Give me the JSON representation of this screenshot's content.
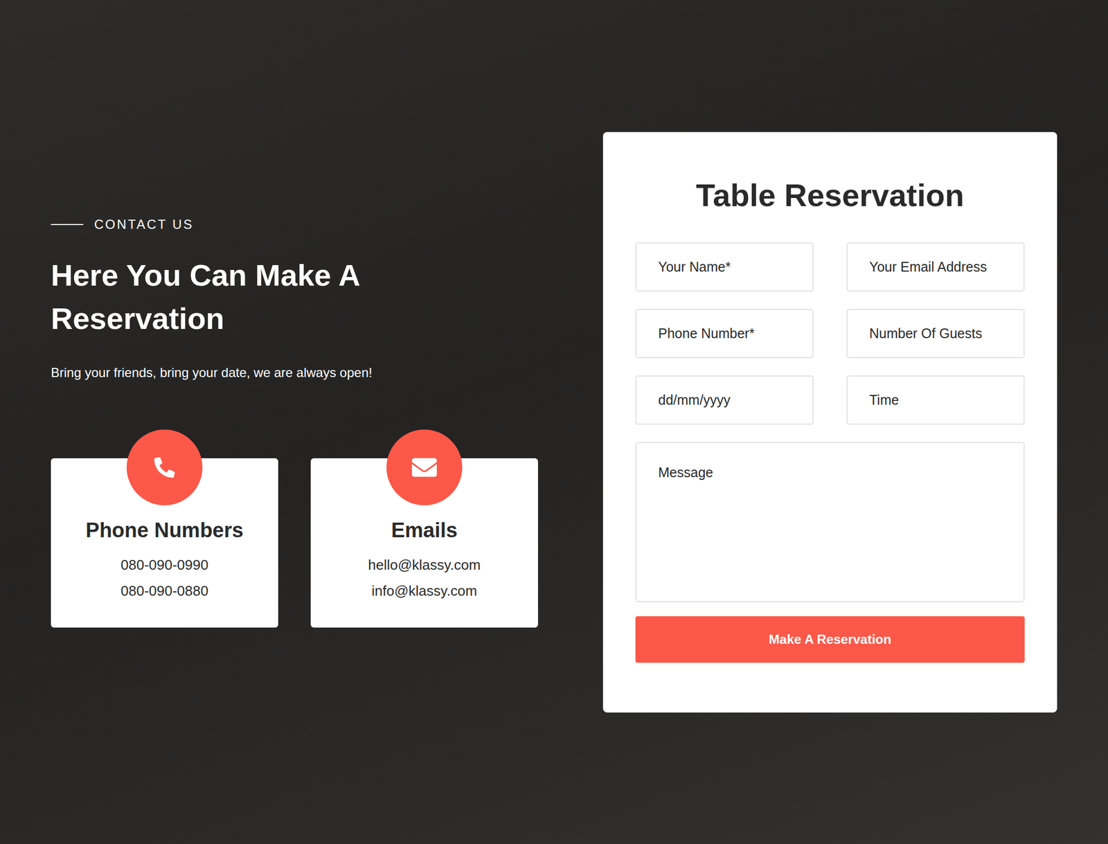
{
  "section": {
    "eyebrow": "CONTACT US",
    "heading": "Here You Can Make A Reservation",
    "subtitle": "Bring your friends, bring your date, we are always open!"
  },
  "contact_cards": [
    {
      "kind": "phone",
      "title": "Phone Numbers",
      "lines": [
        "080-090-0990",
        "080-090-0880"
      ]
    },
    {
      "kind": "email",
      "title": "Emails",
      "lines": [
        "hello@klassy.com",
        "info@klassy.com"
      ]
    }
  ],
  "form": {
    "title": "Table Reservation",
    "fields": [
      {
        "kind": "input",
        "placeholder": "Your Name*"
      },
      {
        "kind": "input",
        "placeholder": "Your Email Address"
      },
      {
        "kind": "input",
        "placeholder": "Phone Number*"
      },
      {
        "kind": "input",
        "placeholder": "Number Of Guests"
      },
      {
        "kind": "input",
        "placeholder": "dd/mm/yyyy"
      },
      {
        "kind": "input",
        "placeholder": "Time"
      },
      {
        "kind": "textarea",
        "placeholder": "Message"
      }
    ],
    "button": "Make A Reservation"
  }
}
